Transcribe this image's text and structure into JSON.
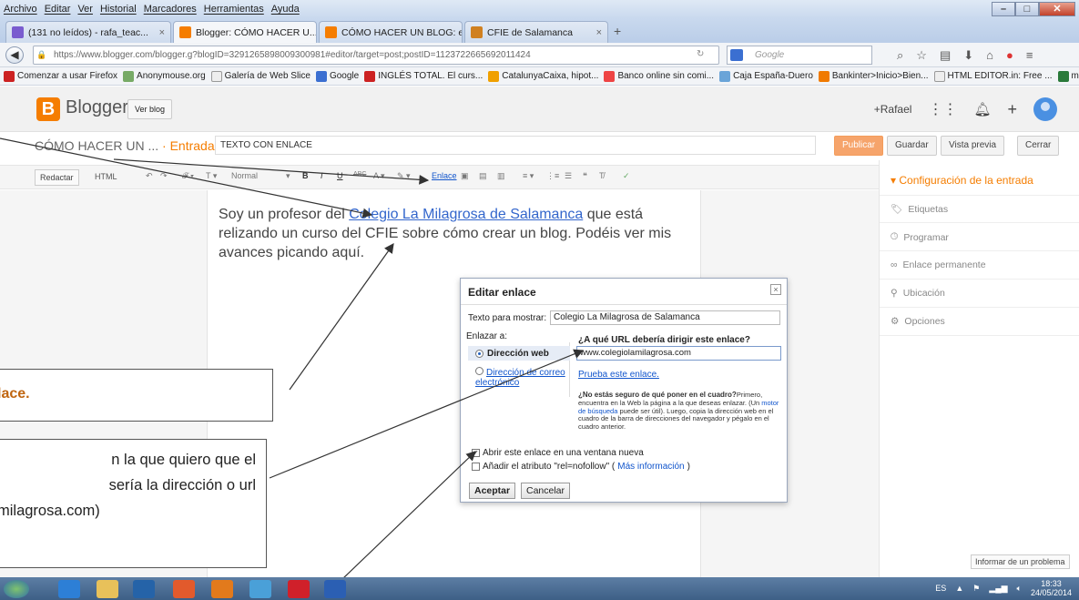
{
  "menubar": [
    "Archivo",
    "Editar",
    "Ver",
    "Historial",
    "Marcadores",
    "Herramientas",
    "Ayuda"
  ],
  "tabs": [
    {
      "label": "(131 no leídos) - rafa_teac...",
      "color": "#7a5ccf"
    },
    {
      "label": "Blogger: CÓMO HACER U...",
      "color": "#f57d00"
    },
    {
      "label": "CÓMO HACER UN BLOG: e...",
      "color": "#f57d00"
    },
    {
      "label": "CFIE de Salamanca",
      "color": "#d08020"
    }
  ],
  "url": "https://www.blogger.com/blogger.g?blogID=3291265898009300981#editor/target=post;postID=1123722665692011424",
  "search_placeholder": "Google",
  "bookmarks": [
    "Comenzar a usar Firefox",
    "Anonymouse.org",
    "Galería de Web Slice",
    "Google",
    "INGLÉS TOTAL. El curs...",
    "CatalunyaCaixa, hipot...",
    "Banco online sin comi...",
    "Caja España-Duero",
    "Bankinter>Inicio>Bien...",
    "HTML EDITOR.in: Free ...",
    "misenlaces"
  ],
  "blogger": {
    "name": "Blogger",
    "ver_blog": "Ver blog",
    "user": "+Rafael"
  },
  "post": {
    "blog_title": "CÓMO HACER UN ...",
    "separator": " · ",
    "entry_label": "Entrada",
    "title_value": "TEXTO CON ENLACE",
    "publish": "Publicar",
    "save": "Guardar",
    "preview": "Vista previa",
    "close": "Cerrar"
  },
  "toolbar": {
    "compose": "Redactar",
    "html": "HTML",
    "font_size": "Normal",
    "link": "Enlace"
  },
  "editor": {
    "text_before": "Soy un profesor del ",
    "link_text": "Colegio La Milagrosa de Salamanca",
    "text_after": " que está relizando un curso del CFIE sobre cómo crear un blog. Podéis ver mis avances picando aquí."
  },
  "sidebar": {
    "heading": "Configuración de la entrada",
    "items": [
      "Etiquetas",
      "Programar",
      "Enlace permanente",
      "Ubicación",
      "Opciones"
    ],
    "report": "Informar de un problema"
  },
  "dialog": {
    "title": "Editar enlace",
    "display_label": "Texto para mostrar:",
    "display_value": "Colegio La Milagrosa de Salamanca",
    "link_to": "Enlazar a:",
    "web_option": "Dirección web",
    "email_option": "Dirección de correo electrónico",
    "url_question": "¿A qué URL debería dirigir este enlace?",
    "url_value": "www.colegiolamilagrosa.com",
    "test_link": "Prueba este enlace.",
    "help_title": "¿No estás seguro de qué poner en el cuadro?",
    "help_p1": "Primero, encuentra en la Web la página a la que deseas enlazar. (Un ",
    "help_link": "motor de búsqueda",
    "help_p2": " puede ser útil). Luego, copia la dirección web en el cuadro de la barra de direcciones del navegador y pégalo en el cuadro anterior.",
    "new_window": "Abrir este enlace en una ventana nueva",
    "nofollow_prefix": "Añadir el atributo \"rel=nofollow\" (",
    "nofollow_link": "Más información",
    "nofollow_suffix": ")",
    "accept": "Aceptar",
    "cancel": "Cancelar"
  },
  "callouts": {
    "box1": "lace.",
    "box2_lines": [
      "n la que quiero que el",
      "sería la dirección o url",
      "milagrosa.com)"
    ]
  },
  "taskbar": {
    "lang": "ES",
    "time": "18:33",
    "date": "24/05/2014"
  }
}
